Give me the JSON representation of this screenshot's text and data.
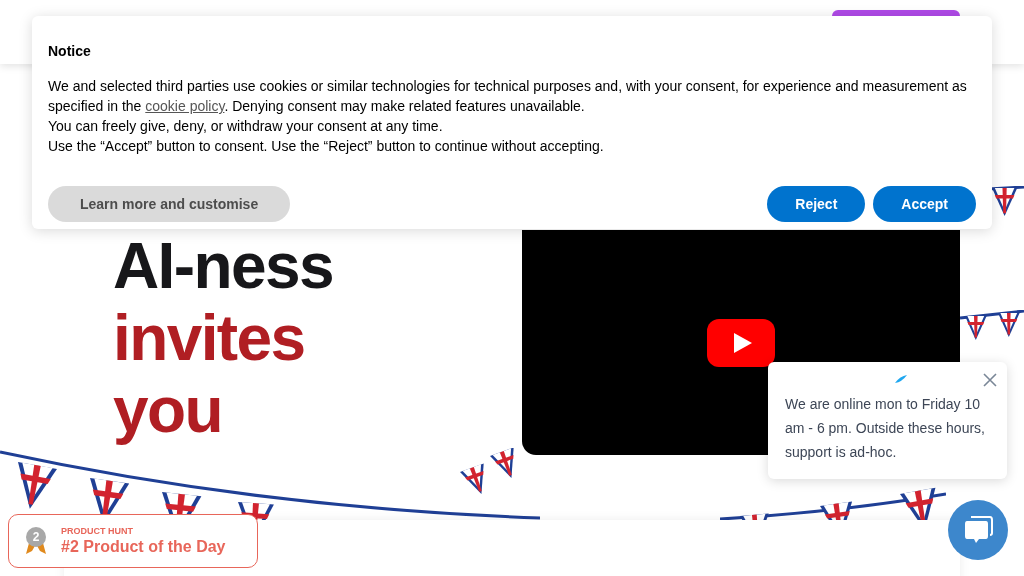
{
  "hero": {
    "headline_dark": "AI-ness",
    "headline_accent_lines": [
      "invites",
      "you"
    ]
  },
  "badge": {
    "rank": "2",
    "label": "PRODUCT HUNT",
    "title": "#2 Product of the Day"
  },
  "notice": {
    "title": "Notice",
    "text_before": "We and selected third parties use cookies or similar technologies for technical purposes and, with your consent, for experience and measurement as specified in the ",
    "link": "cookie policy",
    "text_after": ". Denying consent may make related features unavailable.",
    "lines": [
      "You can freely give, deny, or withdraw your consent at any time.",
      "Use the “Accept” button to consent. Use the “Reject” button to continue without accepting."
    ],
    "buttons": [
      {
        "label": "Learn more and customise",
        "kind": "secondary"
      },
      {
        "label": "Reject",
        "kind": "primary"
      },
      {
        "label": "Accept",
        "kind": "primary"
      }
    ]
  },
  "chat": {
    "message": "We are online mon to Friday 10 am - 6 pm. Outside these hours, support is ad-hoc."
  }
}
